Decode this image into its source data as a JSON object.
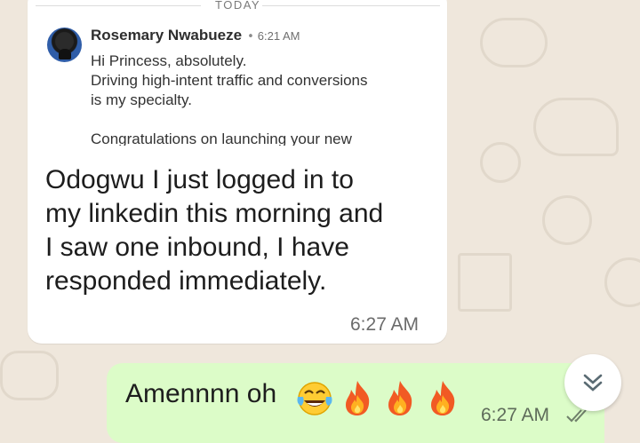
{
  "date_separator": "TODAY",
  "quoted": {
    "sender": "Rosemary Nwabueze",
    "time": "6:21 AM",
    "lines": [
      "Hi Princess, absolutely.",
      "Driving high-intent traffic and conversions",
      "is my specialty.",
      "",
      "Congratulations on launching your new"
    ]
  },
  "incoming": {
    "lines": [
      "Odogwu I just logged in to",
      "my linkedin this morning and",
      "I saw one inbound, I have",
      "responded immediately."
    ],
    "time": "6:27 AM"
  },
  "outgoing": {
    "text": "Amennnn oh",
    "emojis": [
      "face-with-tears-of-joy",
      "fire",
      "fire",
      "fire"
    ],
    "time": "6:27 AM",
    "status_icon": "double-check-icon"
  },
  "scroll_button_icon": "double-chevron-down-icon",
  "colors": {
    "chat_background": "#efe7dc",
    "incoming_bubble": "#ffffff",
    "outgoing_bubble": "#dcfcc8"
  }
}
